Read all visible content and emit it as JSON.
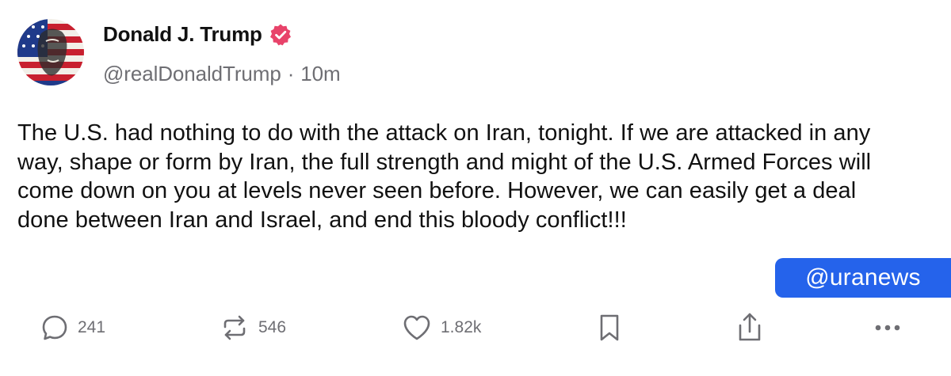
{
  "author": {
    "display_name": "Donald J. Trump",
    "handle": "@realDonaldTrump",
    "separator": "·",
    "time_ago": "10m",
    "verified_color": "#e8436a"
  },
  "post": {
    "text": "The U.S. had nothing to do with the attack on Iran, tonight. If we are attacked in any way, shape or form by Iran, the full strength and might of the U.S. Armed Forces will come down on you at levels never seen before. However, we can easily get a deal done between Iran and Israel, and end this bloody conflict!!!"
  },
  "watermark": {
    "text": "@uranews",
    "color": "#2563eb"
  },
  "actions": {
    "replies": "241",
    "reposts": "546",
    "likes": "1.82k",
    "icons": [
      "reply-icon",
      "repost-icon",
      "like-icon",
      "bookmark-icon",
      "share-icon",
      "more-icon"
    ]
  }
}
